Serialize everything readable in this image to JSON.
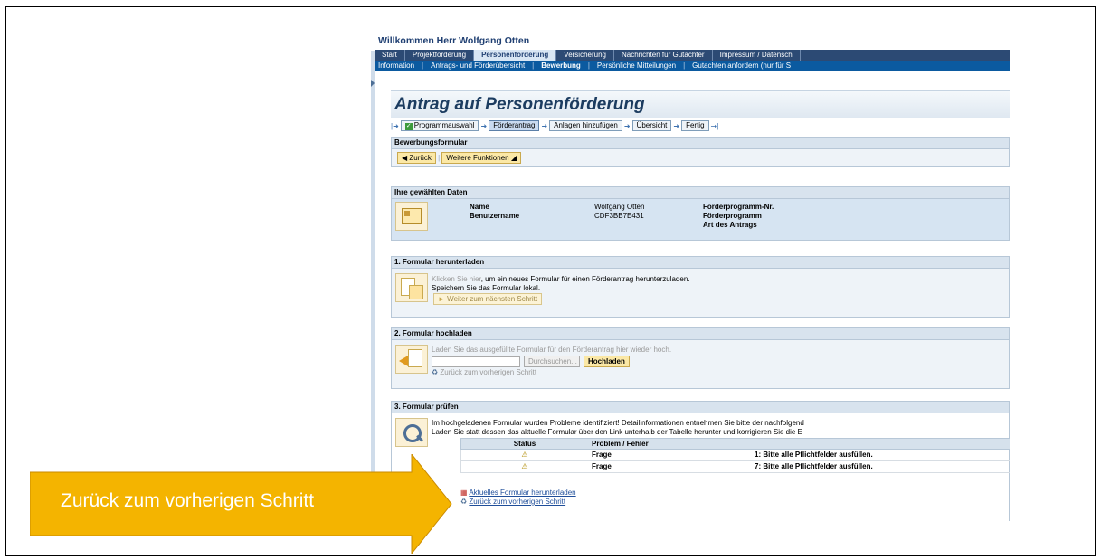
{
  "header": {
    "welcome": "Willkommen Herr Wolfgang Otten"
  },
  "topnav": [
    "Start",
    "Projektförderung",
    "Personenförderung",
    "Versicherung",
    "Nachrichten für Gutachter",
    "Impressum / Datensch"
  ],
  "subnav": [
    "Information",
    "Antrags- und Förderübersicht",
    "Bewerbung",
    "Persönliche Mitteilungen",
    "Gutachten anfordern (nur für S"
  ],
  "page": {
    "title": "Antrag auf Personenförderung"
  },
  "roadmap": [
    "Programmauswahl",
    "Förderantrag",
    "Anlagen hinzufügen",
    "Übersicht",
    "Fertig"
  ],
  "form": {
    "title": "Bewerbungsformular",
    "back_button": "Zurück",
    "more_button": "Weitere Funktionen"
  },
  "selected": {
    "title": "Ihre gewählten Daten",
    "name_label": "Name",
    "name_value": "Wolfgang Otten",
    "user_label": "Benutzername",
    "user_value": "CDF3BB7E431",
    "program_nr_label": "Förderprogramm-Nr.",
    "program_label": "Förderprogramm",
    "type_label": "Art des Antrags"
  },
  "step1": {
    "title": "1. Formular herunterladen",
    "link": "Klicken Sie hier",
    "text": ", um ein neues Formular für einen Förderantrag herunterzuladen.",
    "save": "Speichern Sie das Formular lokal.",
    "button": "Weiter zum nächsten Schritt"
  },
  "step2": {
    "title": "2. Formular hochladen",
    "text": "Laden Sie das ausgefüllte Formular für den Förderantrag hier wieder hoch.",
    "browse": "Durchsuchen...",
    "upload": "Hochladen",
    "back": "Zurück zum vorherigen Schritt"
  },
  "step3": {
    "title": "3. Formular prüfen",
    "text1": "Im hochgeladenen Formular wurden Probleme identifiziert! Detailinformationen entnehmen Sie bitte der nachfolgend",
    "text2": "Laden Sie statt dessen das aktuelle Formular über den Link unterhalb der Tabelle herunter und korrigieren Sie die E",
    "col_status": "Status",
    "col_problem": "Problem / Fehler",
    "rows": [
      {
        "type": "Frage",
        "msg": "1: Bitte alle Pflichtfelder ausfüllen."
      },
      {
        "type": "Frage",
        "msg": "7: Bitte alle Pflichtfelder ausfüllen."
      }
    ],
    "download_link": "Aktuelles Formular herunterladen",
    "back_link": "Zurück zum vorherigen Schritt"
  },
  "callout": {
    "text": "Zurück zum vorherigen Schritt",
    "color": "#f4b400"
  }
}
